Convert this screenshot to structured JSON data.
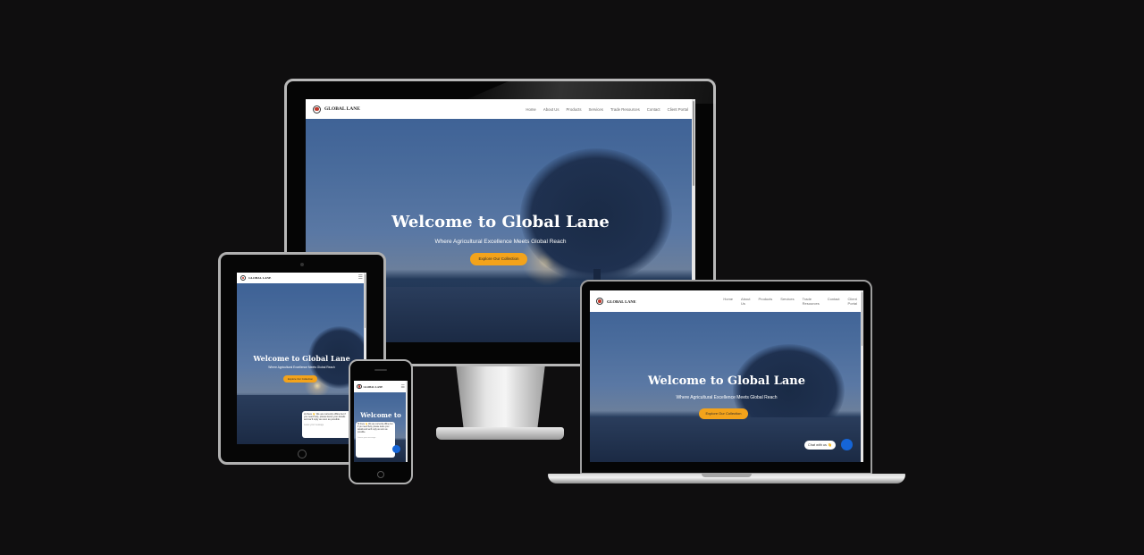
{
  "site": {
    "brand": "GLOBAL LANE",
    "nav": [
      "Home",
      "About Us",
      "Products",
      "Services",
      "Trade Resources",
      "Contact",
      "Client Portal"
    ],
    "laptop_nav": [
      "Home",
      "About\nUs",
      "Products",
      "Services",
      "Trade\nResources",
      "Contact",
      "Client\nPortal"
    ],
    "hero_title": "Welcome to Global Lane",
    "hero_title_short": "Welcome to",
    "hero_subtitle": "Where Agricultural Excellence Meets Global Reach",
    "cta": "Explore Our Collection",
    "chat_label": "Chat with us 👋",
    "chat_message": "Hi there 👋 We are currently offline but if you need help, please leave your details and we'll reply as soon as possible.",
    "chat_leave": "Leave your message"
  },
  "colors": {
    "background": "#0f0e0f",
    "accent": "#f3a31b",
    "chat": "#1565d8"
  },
  "icons": {
    "menu": "hamburger-icon",
    "chat": "chat-bubble-icon"
  }
}
